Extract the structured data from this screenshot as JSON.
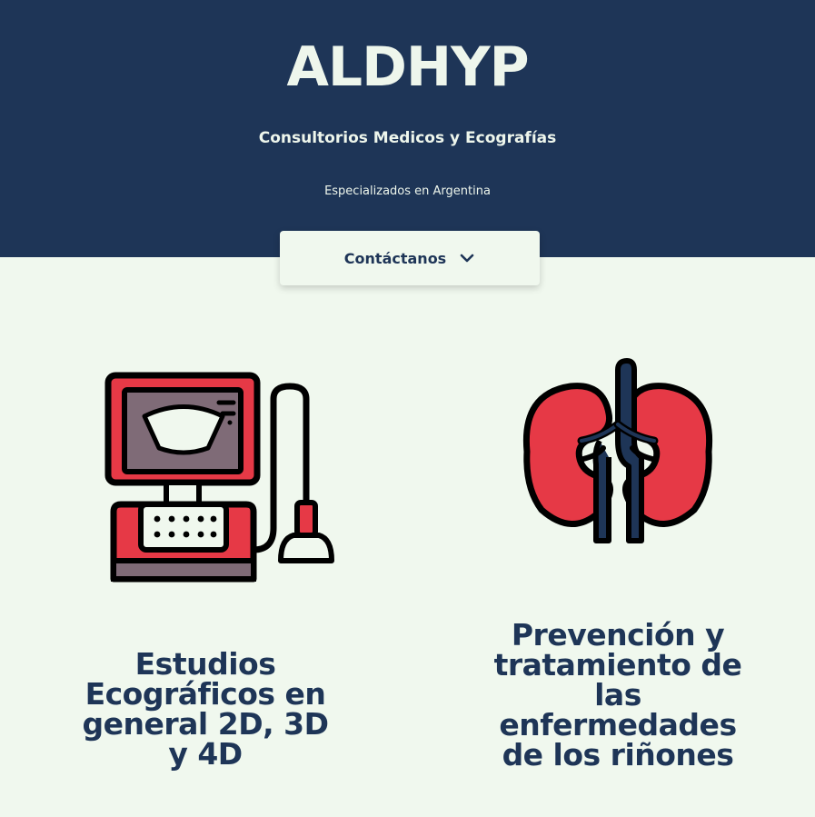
{
  "hero": {
    "brand": "ALDHYP",
    "subtitle": "Consultorios Medicos y Ecografías",
    "tagline": "Especializados en Argentina",
    "contact_label": "Contáctanos",
    "background": "#1e3557",
    "text_color": "#eef6ec"
  },
  "services": [
    {
      "icon": "ultrasound-machine-icon",
      "title": "Estudios Ecográficos en general 2D, 3D y 4D"
    },
    {
      "icon": "kidneys-icon",
      "title": "Prevención y tratamiento de las enfermedades de los riñones"
    }
  ],
  "colors": {
    "accent_red": "#e63946",
    "navy": "#1e3557",
    "page_bg": "#f0f8ee",
    "screen_gray": "#7f6b77"
  }
}
